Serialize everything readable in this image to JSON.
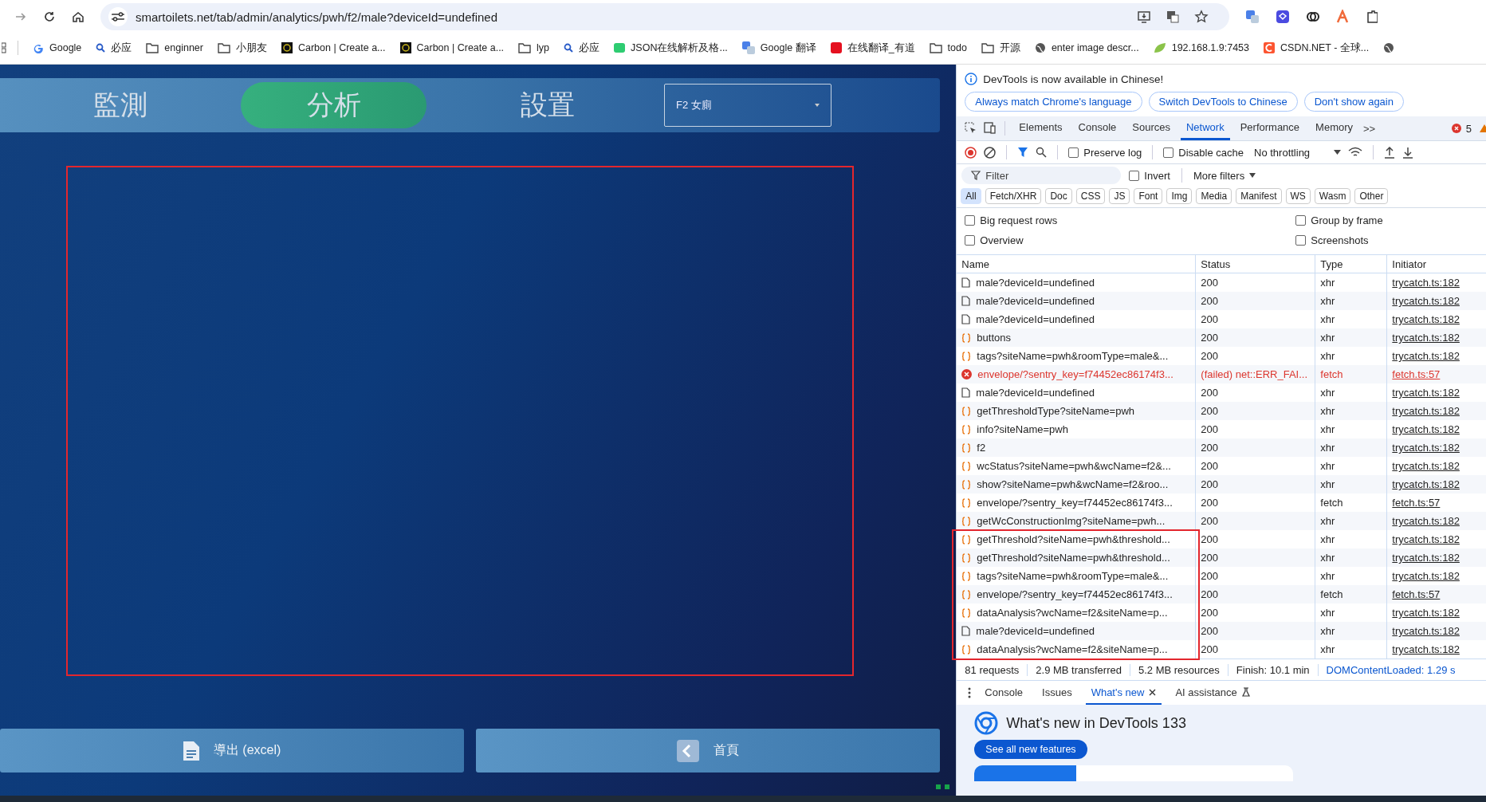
{
  "browser": {
    "url": "smartoilets.net/tab/admin/analytics/pwh/f2/male?deviceId=undefined",
    "bookmarks": [
      {
        "label": "Google",
        "kind": "google"
      },
      {
        "label": "必应",
        "kind": "search"
      },
      {
        "label": "enginner",
        "kind": "folder"
      },
      {
        "label": "小朋友",
        "kind": "folder"
      },
      {
        "label": "Carbon | Create a...",
        "kind": "carbon"
      },
      {
        "label": "Carbon | Create a...",
        "kind": "carbon"
      },
      {
        "label": "lyp",
        "kind": "folder"
      },
      {
        "label": "必应",
        "kind": "search"
      },
      {
        "label": "JSON在线解析及格...",
        "kind": "json"
      },
      {
        "label": "Google 翻译",
        "kind": "translate"
      },
      {
        "label": "在线翻译_有道",
        "kind": "youdao"
      },
      {
        "label": "todo",
        "kind": "folder"
      },
      {
        "label": "开源",
        "kind": "folder"
      },
      {
        "label": "enter image descr...",
        "kind": "globe"
      },
      {
        "label": "192.168.1.9:7453",
        "kind": "leaf"
      },
      {
        "label": "CSDN.NET - 全球...",
        "kind": "csdn"
      },
      {
        "kind": "globe"
      }
    ]
  },
  "app": {
    "tabs": [
      {
        "label": "監測",
        "selected": false
      },
      {
        "label": "分析",
        "selected": true
      },
      {
        "label": "設置",
        "selected": false
      }
    ],
    "select": {
      "value": "F2 女廁"
    },
    "buttons": [
      {
        "label": "導出 (excel)",
        "kind": "export"
      },
      {
        "label": "首頁",
        "kind": "home"
      }
    ]
  },
  "devtools": {
    "banner": {
      "message": "DevTools is now available in Chinese!",
      "buttons": [
        "Always match Chrome's language",
        "Switch DevTools to Chinese",
        "Don't show again"
      ]
    },
    "tabs": [
      {
        "label": "Elements",
        "selected": false
      },
      {
        "label": "Console",
        "selected": false
      },
      {
        "label": "Sources",
        "selected": false
      },
      {
        "label": "Network",
        "selected": true
      },
      {
        "label": "Performance",
        "selected": false
      },
      {
        "label": "Memory",
        "selected": false
      }
    ],
    "more_tabs": ">>",
    "error_count": "5",
    "toolbar": {
      "preserve_log": {
        "label": "Preserve log",
        "checked": false
      },
      "disable_cache": {
        "label": "Disable cache",
        "checked": false
      },
      "throttling": "No throttling"
    },
    "filter": {
      "placeholder": "Filter",
      "invert": {
        "label": "Invert",
        "checked": false
      },
      "more_filters": "More filters"
    },
    "types": [
      {
        "label": "All",
        "selected": true
      },
      {
        "label": "Fetch/XHR",
        "selected": false
      },
      {
        "label": "Doc",
        "selected": false
      },
      {
        "label": "CSS",
        "selected": false
      },
      {
        "label": "JS",
        "selected": false
      },
      {
        "label": "Font",
        "selected": false
      },
      {
        "label": "Img",
        "selected": false
      },
      {
        "label": "Media",
        "selected": false
      },
      {
        "label": "Manifest",
        "selected": false
      },
      {
        "label": "WS",
        "selected": false
      },
      {
        "label": "Wasm",
        "selected": false
      },
      {
        "label": "Other",
        "selected": false
      }
    ],
    "options": [
      {
        "label": "Big request rows",
        "checked": false
      },
      {
        "label": "Group by frame",
        "checked": false
      },
      {
        "label": "Overview",
        "checked": false
      },
      {
        "label": "Screenshots",
        "checked": false
      }
    ],
    "columns": [
      "Name",
      "Status",
      "Type",
      "Initiator"
    ],
    "rows": [
      {
        "kind": "doc",
        "name": "male?deviceId=undefined",
        "status": "200",
        "type": "xhr",
        "initiator": "trycatch.ts:182"
      },
      {
        "kind": "doc",
        "name": "male?deviceId=undefined",
        "status": "200",
        "type": "xhr",
        "initiator": "trycatch.ts:182"
      },
      {
        "kind": "doc",
        "name": "male?deviceId=undefined",
        "status": "200",
        "type": "xhr",
        "initiator": "trycatch.ts:182"
      },
      {
        "kind": "fetch",
        "name": "buttons",
        "status": "200",
        "type": "xhr",
        "initiator": "trycatch.ts:182"
      },
      {
        "kind": "fetch",
        "name": "tags?siteName=pwh&roomType=male&...",
        "status": "200",
        "type": "xhr",
        "initiator": "trycatch.ts:182"
      },
      {
        "kind": "error",
        "name": "envelope/?sentry_key=f74452ec86174f3...",
        "status": "(failed) net::ERR_FAI...",
        "type": "fetch",
        "initiator": "fetch.ts:57"
      },
      {
        "kind": "doc",
        "name": "male?deviceId=undefined",
        "status": "200",
        "type": "xhr",
        "initiator": "trycatch.ts:182"
      },
      {
        "kind": "fetch",
        "name": "getThresholdType?siteName=pwh",
        "status": "200",
        "type": "xhr",
        "initiator": "trycatch.ts:182"
      },
      {
        "kind": "fetch",
        "name": "info?siteName=pwh",
        "status": "200",
        "type": "xhr",
        "initiator": "trycatch.ts:182"
      },
      {
        "kind": "fetch",
        "name": "f2",
        "status": "200",
        "type": "xhr",
        "initiator": "trycatch.ts:182"
      },
      {
        "kind": "fetch",
        "name": "wcStatus?siteName=pwh&wcName=f2&...",
        "status": "200",
        "type": "xhr",
        "initiator": "trycatch.ts:182"
      },
      {
        "kind": "fetch",
        "name": "show?siteName=pwh&wcName=f2&roo...",
        "status": "200",
        "type": "xhr",
        "initiator": "trycatch.ts:182"
      },
      {
        "kind": "fetch",
        "name": "envelope/?sentry_key=f74452ec86174f3...",
        "status": "200",
        "type": "fetch",
        "initiator": "fetch.ts:57"
      },
      {
        "kind": "fetch",
        "name": "getWcConstructionImg?siteName=pwh...",
        "status": "200",
        "type": "xhr",
        "initiator": "trycatch.ts:182"
      },
      {
        "kind": "fetch",
        "name": "getThreshold?siteName=pwh&threshold...",
        "status": "200",
        "type": "xhr",
        "initiator": "trycatch.ts:182"
      },
      {
        "kind": "fetch",
        "name": "getThreshold?siteName=pwh&threshold...",
        "status": "200",
        "type": "xhr",
        "initiator": "trycatch.ts:182"
      },
      {
        "kind": "fetch",
        "name": "tags?siteName=pwh&roomType=male&...",
        "status": "200",
        "type": "xhr",
        "initiator": "trycatch.ts:182"
      },
      {
        "kind": "fetch",
        "name": "envelope/?sentry_key=f74452ec86174f3...",
        "status": "200",
        "type": "fetch",
        "initiator": "fetch.ts:57"
      },
      {
        "kind": "fetch",
        "name": "dataAnalysis?wcName=f2&siteName=p...",
        "status": "200",
        "type": "xhr",
        "initiator": "trycatch.ts:182"
      },
      {
        "kind": "doc",
        "name": "male?deviceId=undefined",
        "status": "200",
        "type": "xhr",
        "initiator": "trycatch.ts:182"
      },
      {
        "kind": "fetch",
        "name": "dataAnalysis?wcName=f2&siteName=p...",
        "status": "200",
        "type": "xhr",
        "initiator": "trycatch.ts:182"
      }
    ],
    "summary": [
      "81 requests",
      "2.9 MB transferred",
      "5.2 MB resources",
      "Finish: 10.1 min",
      "DOMContentLoaded: 1.29 s"
    ],
    "drawer_tabs": [
      {
        "label": "Console",
        "selected": false,
        "kind": "plain"
      },
      {
        "label": "Issues",
        "selected": false,
        "kind": "plain"
      },
      {
        "label": "What's new",
        "selected": true,
        "kind": "closable"
      },
      {
        "label": "AI assistance",
        "selected": false,
        "kind": "flask"
      }
    ],
    "whats_new": {
      "title": "What's new in DevTools 133",
      "button": "See all new features"
    }
  }
}
